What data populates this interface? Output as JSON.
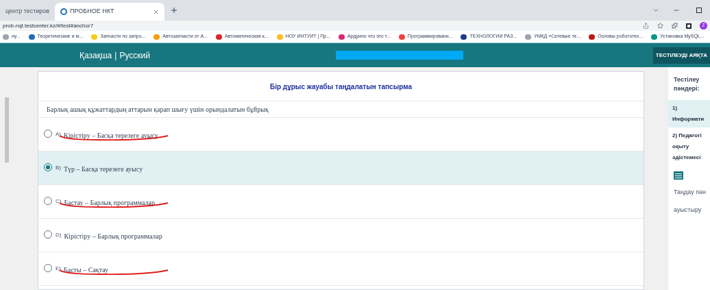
{
  "browser": {
    "tabs": [
      {
        "title": "центр тестиров",
        "selected": false
      },
      {
        "title": "ПРОБНОЕ НКТ",
        "selected": true
      }
    ],
    "address": "prob-nqt.testcenter.kz/#/test#anchor7",
    "bookmarks": [
      {
        "label": "ну...",
        "color": "#9ca3af"
      },
      {
        "label": "Теоретические и м...",
        "color": "#1e6fb8"
      },
      {
        "label": "Запчасти по запро...",
        "color": "#facc15"
      },
      {
        "label": "Автозапчасти от А...",
        "color": "#f59e0b"
      },
      {
        "label": "Автоматическая к...",
        "color": "#dc2626"
      },
      {
        "label": "НОУ ИНТУИТ | Пр...",
        "color": "#fbbf24"
      },
      {
        "label": "Ардуино что это т...",
        "color": "#db2777"
      },
      {
        "label": "Программировани...",
        "color": "#ef4444"
      },
      {
        "label": "ТЕХНОЛОГИИ РАЗ...",
        "color": "#1e3a8a"
      },
      {
        "label": "УМКД «Сетевые те...",
        "color": "#9ca3af"
      },
      {
        "label": "Основы робототех...",
        "color": "#b91c1c"
      },
      {
        "label": "Установка MySQL...",
        "color": "#0d9488"
      }
    ],
    "profile": "Z"
  },
  "header": {
    "languages": [
      "Қазақша",
      "Русский"
    ],
    "separator": "|",
    "finish_button": "ТЕСТІЛЕУДІ АЯҚТА"
  },
  "question": {
    "title": "Бір дұрыс жауабы таңдалатын тапсырма",
    "text": "Барлық ашық құжаттардың аттарын қарап шығу үшін орындалатын бұйрық",
    "options": [
      {
        "letter": "A)",
        "text": "Кірістіру – Басқа терезеге ауысу",
        "selected": false,
        "underlined": true
      },
      {
        "letter": "B)",
        "text": "Түр – Басқа терезеге ауысу",
        "selected": true,
        "underlined": false
      },
      {
        "letter": "C)",
        "text": "Бастау – Барлық программалар",
        "selected": false,
        "underlined": true
      },
      {
        "letter": "D)",
        "text": "Кірістіру – Барлық программалар",
        "selected": false,
        "underlined": false
      },
      {
        "letter": "E)",
        "text": "Басты – Сақтау",
        "selected": false,
        "underlined": true
      }
    ]
  },
  "sidebar": {
    "heading": "Тестілеу пәндері:",
    "subjects": [
      {
        "label": "1) Информати",
        "selected": true
      },
      {
        "label": "2) Педагогі оқыту әдістемесі",
        "selected": false
      }
    ],
    "lines": [
      "Таңдау пән",
      "ауыстыру"
    ]
  }
}
